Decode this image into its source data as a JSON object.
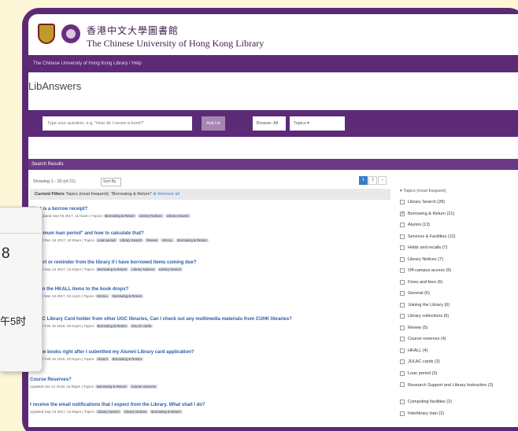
{
  "brand": {
    "name_zh": "香港中文大學圖書館",
    "name_en": "The Chinese University of Hong Kong Library"
  },
  "breadcrumb": "The Chinese University of Hong Kong Library / Help",
  "page_title": "LibAnswers",
  "search": {
    "placeholder": "Type your question, e.g. \"How do I renew a book?\"",
    "ask_label": "Ask Us",
    "browse_label": "Browse:",
    "browse_value": "All",
    "topics_label": "Topics"
  },
  "results": {
    "header": "Search Results",
    "showing": "Showing 1 - 20 (of 21)",
    "sort_label": "Sort By",
    "pages": [
      "1",
      "2",
      "»"
    ],
    "current_filters_label": "Current Filters",
    "current_filters_value": "Topics (most frequent): \"Borrowing & Return\"",
    "remove_all": "Remove all",
    "items": [
      {
        "title": "What is a borrow receipt?",
        "meta": "Last Updated  Sep 05 2017, 11:01am  |  Topics",
        "tags": [
          "Borrowing & Return",
          "Library Notices",
          "Library Search"
        ]
      },
      {
        "title": "\"maximum loan period\" and how to calculate that?",
        "meta": "Updated  Dec 18 2017, 10:55am  |  Topics",
        "tags": [
          "Loan period",
          "Library Search",
          "Renew",
          "HKALL",
          "Borrowing & Return"
        ]
      },
      {
        "title": "an alert or reminder from the library if I have borrowed items coming due?",
        "meta": "Updated  Sep 13 2017, 12:02pm  |  Topics",
        "tags": [
          "Borrowing & Return",
          "Library Notices",
          "Library Search"
        ]
      },
      {
        "title": "Return the HKALL items to the book drops?",
        "meta": "Updated  Mar 13 2017, 03:11pm  |  Topics",
        "tags": [
          "HKALL",
          "Borrowing & Return"
        ]
      },
      {
        "title": "JULAC Library Card holder from other UGC libraries, Can I check out any multimedia materials from CUHK libraries?",
        "meta": "Updated  Feb 16 2018, 02:51pm  |  Topics",
        "tags": [
          "Borrowing & Return",
          "JULAC cards"
        ]
      },
      {
        "title": "borrow books right after I submitted my Alumni Library card application?",
        "meta": "Updated  Feb 16 2018, 02:51pm  |  Topics",
        "tags": [
          "Alumni",
          "Borrowing & Return"
        ]
      },
      {
        "title": "Course Reserves?",
        "meta": "Updated  Jan 21 2018, 04:06pm  |  Topics",
        "tags": [
          "Borrowing & Return",
          "Course reserves"
        ]
      },
      {
        "title": "t receive the email notifications that I expect from the Library. What shall I do?",
        "meta": "Updated  Sep 13 2017, 12:06pm  |  Topics",
        "tags": [
          "Library Search",
          "Library Notices",
          "Borrowing & Return"
        ]
      }
    ]
  },
  "sidebar": {
    "heading": "Topics (most frequent)",
    "items": [
      {
        "label": "Library Search (28)",
        "checked": false
      },
      {
        "label": "Borrowing & Return (21)",
        "checked": true
      },
      {
        "label": "Alumni (13)",
        "checked": false
      },
      {
        "label": "Services & Facilities (12)",
        "checked": false
      },
      {
        "label": "Holds and recalls (7)",
        "checked": false
      },
      {
        "label": "Library Notices (7)",
        "checked": false
      },
      {
        "label": "Off-campus access (6)",
        "checked": false
      },
      {
        "label": "Fines and fees (6)",
        "checked": false
      },
      {
        "label": "General (6)",
        "checked": false
      },
      {
        "label": "Joining the Library (6)",
        "checked": false
      },
      {
        "label": "Library collections (6)",
        "checked": false
      },
      {
        "label": "Renew (5)",
        "checked": false
      },
      {
        "label": "Course reserves (4)",
        "checked": false
      },
      {
        "label": "HKALL (4)",
        "checked": false
      },
      {
        "label": "JULAC cards (3)",
        "checked": false
      },
      {
        "label": "Loan period (3)",
        "checked": false
      },
      {
        "label": "Research Support and Library Instruction (3)",
        "checked": false
      },
      {
        "label": "Computing facilities (2)",
        "checked": false
      },
      {
        "label": "Interlibrary loan (2)",
        "checked": false
      }
    ]
  },
  "overlay": {
    "number": "8",
    "text": "午5时"
  },
  "colors": {
    "background": "#fdf6d7",
    "frame": "#5b2a74",
    "navbar": "#5d2a77",
    "link": "#2b5ca8"
  }
}
